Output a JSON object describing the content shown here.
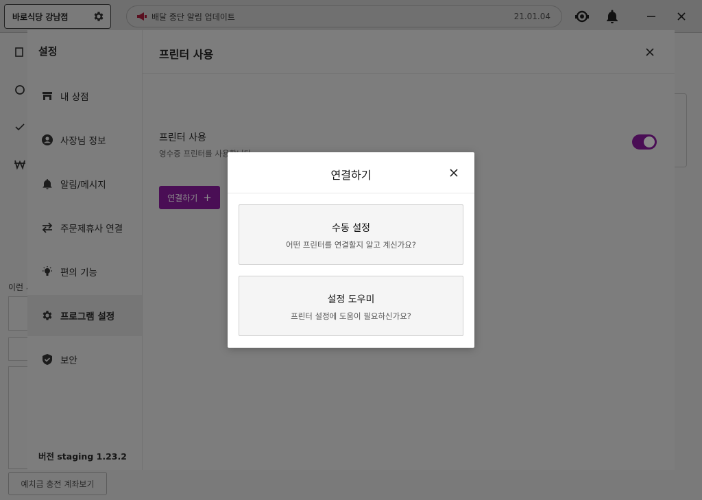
{
  "topbar": {
    "store_name": "바로식당 강남점",
    "notice_text": "배달 중단 알림 업데이트",
    "notice_date": "21.01.04"
  },
  "background": {
    "recent_label": "이런 서",
    "deposit_button": "예치금 충전 계좌보기"
  },
  "settings": {
    "title": "설정",
    "menu": [
      {
        "label": "내 상점",
        "icon": "store-icon"
      },
      {
        "label": "사장님 정보",
        "icon": "account-circle-icon"
      },
      {
        "label": "알림/메시지",
        "icon": "bell-icon"
      },
      {
        "label": "주문제휴사 연결",
        "icon": "swap-arrows-icon"
      },
      {
        "label": "편의 기능",
        "icon": "lightbulb-icon"
      },
      {
        "label": "프로그램 설정",
        "icon": "gear-icon",
        "active": true
      },
      {
        "label": "보안",
        "icon": "shield-check-icon"
      }
    ],
    "version": "버전 staging 1.23.2",
    "main": {
      "title": "프린터 사용",
      "printer_label": "프린터 사용",
      "printer_desc": "영수증 프린터를 사용합니다",
      "toggle_on": true,
      "connect_button": "연결하기",
      "connect_plus": "+"
    }
  },
  "modal": {
    "title": "연결하기",
    "options": [
      {
        "title": "수동 설정",
        "desc": "어떤 프린터를 연결할지 알고 계신가요?"
      },
      {
        "title": "설정 도우미",
        "desc": "프린터 설정에 도움이 필요하신가요?"
      }
    ]
  },
  "colors": {
    "accent": "#7b1fa2",
    "overlay": "rgba(0,0,0,0.5)"
  }
}
